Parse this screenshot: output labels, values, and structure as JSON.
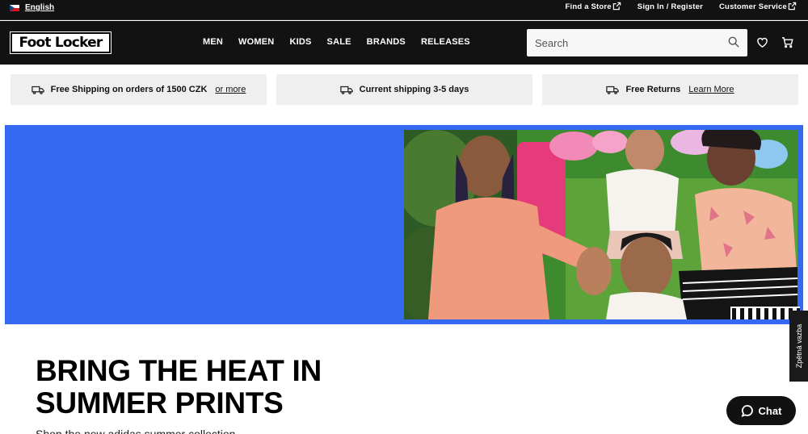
{
  "utility_bar": {
    "language": "English",
    "links": [
      {
        "label": "Find a Store",
        "external": true
      },
      {
        "label": "Sign In / Register",
        "external": false
      },
      {
        "label": "Customer Service",
        "external": true
      }
    ]
  },
  "header": {
    "logo_text": "Foot Locker",
    "nav": [
      "MEN",
      "WOMEN",
      "KIDS",
      "SALE",
      "BRANDS",
      "RELEASES"
    ],
    "search_placeholder": "Search",
    "icons": [
      "search-icon",
      "heart-icon",
      "cart-icon"
    ]
  },
  "shipping": [
    {
      "text": "Free Shipping on orders of 1500 CZK",
      "link": "or more",
      "icon": "truck-icon"
    },
    {
      "text": "Current shipping 3-5 days",
      "link": "",
      "icon": "truck-icon"
    },
    {
      "text": "Free Returns",
      "link": "Learn More",
      "icon": "truck-icon"
    }
  ],
  "hero": {
    "headline": "BRING THE HEAT IN SUMMER PRINTS",
    "subline": "Shop the new adidas summer collection"
  },
  "feedback_label": "Zpětná vazba",
  "chat_label": "Chat",
  "colors": {
    "header_bg": "#121212",
    "hero_blue": "#3469f2",
    "shipping_bg": "#efefef"
  }
}
